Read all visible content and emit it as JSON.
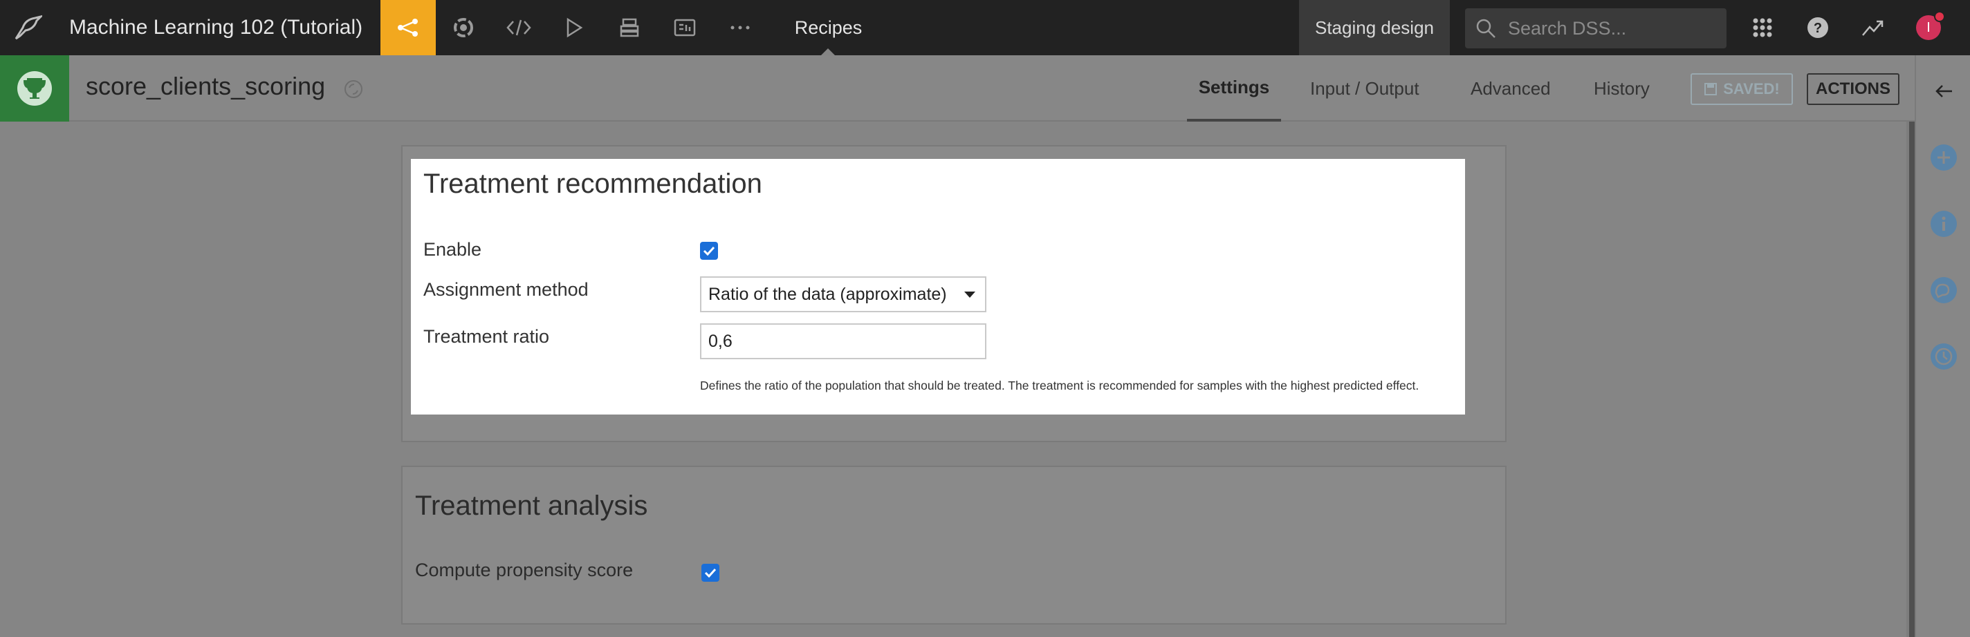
{
  "topnav": {
    "project_title": "Machine Learning 102 (Tutorial)",
    "recipes_label": "Recipes",
    "staging_label": "Staging design",
    "search_placeholder": "Search DSS...",
    "avatar_initial": "I",
    "notification_count": "1",
    "icons": [
      "flow-icon",
      "recycle-icon",
      "code-icon",
      "run-icon",
      "database-icon",
      "dashboard-icon",
      "more-icon",
      "apps-grid-icon",
      "help-icon",
      "trend-icon"
    ],
    "accent_color": "#f2a81f"
  },
  "subheader": {
    "recipe_name": "score_clients_scoring",
    "tabs": [
      {
        "label": "Settings",
        "active": true
      },
      {
        "label": "Input / Output",
        "active": false
      },
      {
        "label": "Advanced",
        "active": false
      },
      {
        "label": "History",
        "active": false
      }
    ],
    "saved_label": "SAVED!",
    "actions_label": "ACTIONS",
    "recipe_color": "#2e7d3a"
  },
  "treatment_recommendation": {
    "title": "Treatment recommendation",
    "enable_label": "Enable",
    "enable_checked": true,
    "assignment_label": "Assignment method",
    "assignment_value": "Ratio of the data (approximate)",
    "ratio_label": "Treatment ratio",
    "ratio_value": "0,6",
    "help_text": "Defines the ratio of the population that should be treated. The treatment is recommended for samples with the highest predicted effect."
  },
  "treatment_analysis": {
    "title": "Treatment analysis",
    "propensity_label": "Compute propensity score",
    "propensity_checked": true
  },
  "rightbar": {
    "icons": [
      "collapse-arrow-icon",
      "add-icon",
      "info-icon",
      "discussion-icon",
      "timeline-icon"
    ]
  }
}
